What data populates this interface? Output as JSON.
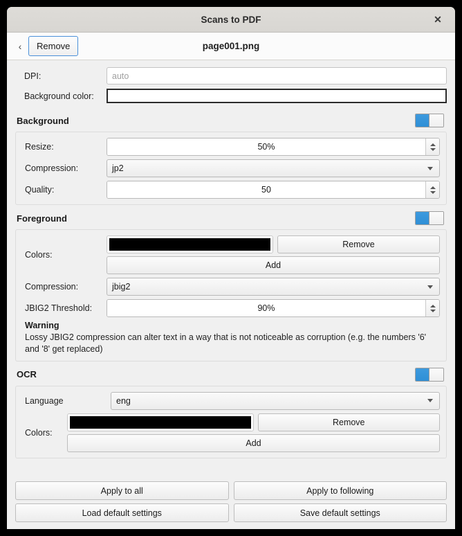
{
  "window": {
    "title": "Scans to PDF",
    "close_icon": "close-icon"
  },
  "header": {
    "back_icon": "‹",
    "remove_label": "Remove",
    "filename": "page001.png"
  },
  "top_fields": {
    "dpi_label": "DPI:",
    "dpi_value": "",
    "dpi_placeholder": "auto",
    "bgcolor_label": "Background color:",
    "bgcolor_value": "#ffffff"
  },
  "background": {
    "title": "Background",
    "enabled": true,
    "resize_label": "Resize:",
    "resize_value": "50%",
    "compression_label": "Compression:",
    "compression_value": "jp2",
    "quality_label": "Quality:",
    "quality_value": "50"
  },
  "foreground": {
    "title": "Foreground",
    "enabled": true,
    "colors_label": "Colors:",
    "color_swatch": "#000000",
    "remove_label": "Remove",
    "add_label": "Add",
    "compression_label": "Compression:",
    "compression_value": "jbig2",
    "threshold_label": "JBIG2 Threshold:",
    "threshold_value": "90%",
    "warning_title": "Warning",
    "warning_text": "Lossy JBIG2 compression can alter text in a way that is not noticeable as corruption (e.g. the numbers '6' and '8' get replaced)"
  },
  "ocr": {
    "title": "OCR",
    "enabled": true,
    "language_label": "Language",
    "language_value": "eng",
    "colors_label": "Colors:",
    "color_swatch": "#000000",
    "remove_label": "Remove",
    "add_label": "Add"
  },
  "bottom_buttons": {
    "apply_all": "Apply to all",
    "apply_following": "Apply to following",
    "load_defaults": "Load default settings",
    "save_defaults": "Save default settings"
  },
  "colors": {
    "accent": "#3d9ade",
    "focus_border": "#4a90d9",
    "window_bg": "#f0f0f0",
    "titlebar_bg": "#dedcd8"
  }
}
